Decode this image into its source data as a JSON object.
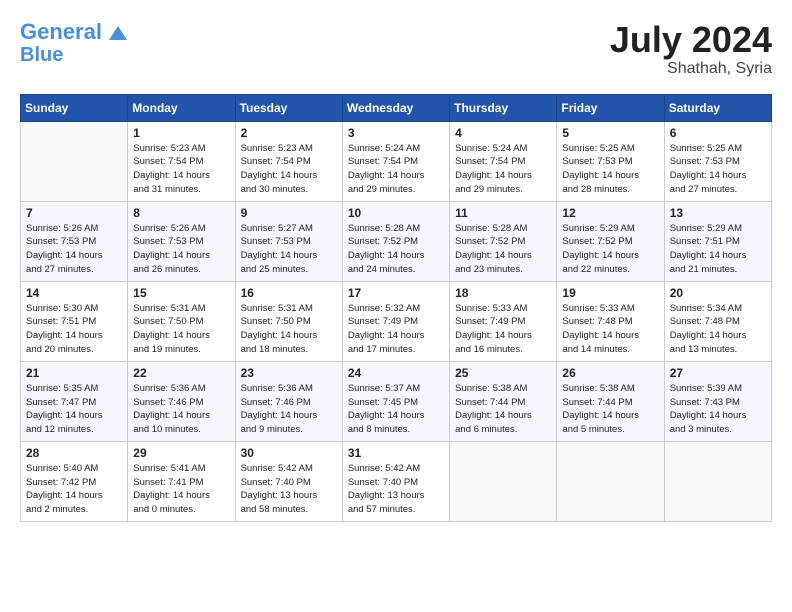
{
  "header": {
    "logo_line1": "General",
    "logo_line2": "Blue",
    "month_year": "July 2024",
    "location": "Shathah, Syria"
  },
  "columns": [
    "Sunday",
    "Monday",
    "Tuesday",
    "Wednesday",
    "Thursday",
    "Friday",
    "Saturday"
  ],
  "weeks": [
    [
      {
        "day": "",
        "text": ""
      },
      {
        "day": "1",
        "text": "Sunrise: 5:23 AM\nSunset: 7:54 PM\nDaylight: 14 hours\nand 31 minutes."
      },
      {
        "day": "2",
        "text": "Sunrise: 5:23 AM\nSunset: 7:54 PM\nDaylight: 14 hours\nand 30 minutes."
      },
      {
        "day": "3",
        "text": "Sunrise: 5:24 AM\nSunset: 7:54 PM\nDaylight: 14 hours\nand 29 minutes."
      },
      {
        "day": "4",
        "text": "Sunrise: 5:24 AM\nSunset: 7:54 PM\nDaylight: 14 hours\nand 29 minutes."
      },
      {
        "day": "5",
        "text": "Sunrise: 5:25 AM\nSunset: 7:53 PM\nDaylight: 14 hours\nand 28 minutes."
      },
      {
        "day": "6",
        "text": "Sunrise: 5:25 AM\nSunset: 7:53 PM\nDaylight: 14 hours\nand 27 minutes."
      }
    ],
    [
      {
        "day": "7",
        "text": "Sunrise: 5:26 AM\nSunset: 7:53 PM\nDaylight: 14 hours\nand 27 minutes."
      },
      {
        "day": "8",
        "text": "Sunrise: 5:26 AM\nSunset: 7:53 PM\nDaylight: 14 hours\nand 26 minutes."
      },
      {
        "day": "9",
        "text": "Sunrise: 5:27 AM\nSunset: 7:53 PM\nDaylight: 14 hours\nand 25 minutes."
      },
      {
        "day": "10",
        "text": "Sunrise: 5:28 AM\nSunset: 7:52 PM\nDaylight: 14 hours\nand 24 minutes."
      },
      {
        "day": "11",
        "text": "Sunrise: 5:28 AM\nSunset: 7:52 PM\nDaylight: 14 hours\nand 23 minutes."
      },
      {
        "day": "12",
        "text": "Sunrise: 5:29 AM\nSunset: 7:52 PM\nDaylight: 14 hours\nand 22 minutes."
      },
      {
        "day": "13",
        "text": "Sunrise: 5:29 AM\nSunset: 7:51 PM\nDaylight: 14 hours\nand 21 minutes."
      }
    ],
    [
      {
        "day": "14",
        "text": "Sunrise: 5:30 AM\nSunset: 7:51 PM\nDaylight: 14 hours\nand 20 minutes."
      },
      {
        "day": "15",
        "text": "Sunrise: 5:31 AM\nSunset: 7:50 PM\nDaylight: 14 hours\nand 19 minutes."
      },
      {
        "day": "16",
        "text": "Sunrise: 5:31 AM\nSunset: 7:50 PM\nDaylight: 14 hours\nand 18 minutes."
      },
      {
        "day": "17",
        "text": "Sunrise: 5:32 AM\nSunset: 7:49 PM\nDaylight: 14 hours\nand 17 minutes."
      },
      {
        "day": "18",
        "text": "Sunrise: 5:33 AM\nSunset: 7:49 PM\nDaylight: 14 hours\nand 16 minutes."
      },
      {
        "day": "19",
        "text": "Sunrise: 5:33 AM\nSunset: 7:48 PM\nDaylight: 14 hours\nand 14 minutes."
      },
      {
        "day": "20",
        "text": "Sunrise: 5:34 AM\nSunset: 7:48 PM\nDaylight: 14 hours\nand 13 minutes."
      }
    ],
    [
      {
        "day": "21",
        "text": "Sunrise: 5:35 AM\nSunset: 7:47 PM\nDaylight: 14 hours\nand 12 minutes."
      },
      {
        "day": "22",
        "text": "Sunrise: 5:36 AM\nSunset: 7:46 PM\nDaylight: 14 hours\nand 10 minutes."
      },
      {
        "day": "23",
        "text": "Sunrise: 5:36 AM\nSunset: 7:46 PM\nDaylight: 14 hours\nand 9 minutes."
      },
      {
        "day": "24",
        "text": "Sunrise: 5:37 AM\nSunset: 7:45 PM\nDaylight: 14 hours\nand 8 minutes."
      },
      {
        "day": "25",
        "text": "Sunrise: 5:38 AM\nSunset: 7:44 PM\nDaylight: 14 hours\nand 6 minutes."
      },
      {
        "day": "26",
        "text": "Sunrise: 5:38 AM\nSunset: 7:44 PM\nDaylight: 14 hours\nand 5 minutes."
      },
      {
        "day": "27",
        "text": "Sunrise: 5:39 AM\nSunset: 7:43 PM\nDaylight: 14 hours\nand 3 minutes."
      }
    ],
    [
      {
        "day": "28",
        "text": "Sunrise: 5:40 AM\nSunset: 7:42 PM\nDaylight: 14 hours\nand 2 minutes."
      },
      {
        "day": "29",
        "text": "Sunrise: 5:41 AM\nSunset: 7:41 PM\nDaylight: 14 hours\nand 0 minutes."
      },
      {
        "day": "30",
        "text": "Sunrise: 5:42 AM\nSunset: 7:40 PM\nDaylight: 13 hours\nand 58 minutes."
      },
      {
        "day": "31",
        "text": "Sunrise: 5:42 AM\nSunset: 7:40 PM\nDaylight: 13 hours\nand 57 minutes."
      },
      {
        "day": "",
        "text": ""
      },
      {
        "day": "",
        "text": ""
      },
      {
        "day": "",
        "text": ""
      }
    ]
  ]
}
